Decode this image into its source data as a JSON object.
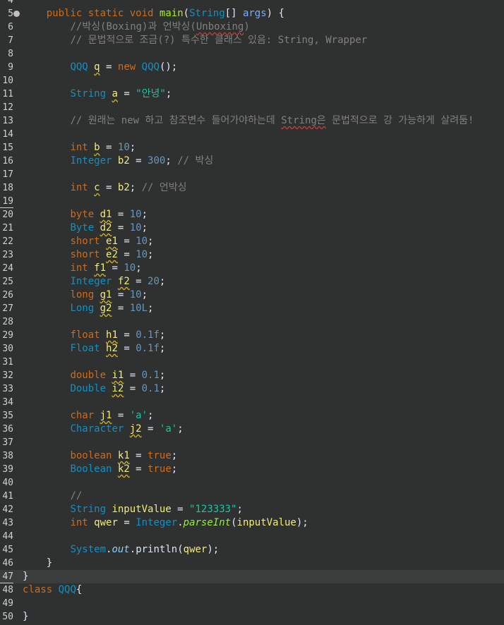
{
  "editor": {
    "first_line_number": "4",
    "current_line": 47,
    "lines": [
      {
        "n": "4",
        "tokens": []
      },
      {
        "n": "5",
        "fold": true,
        "tokens": [
          {
            "t": "    ",
            "c": "plain"
          },
          {
            "t": "public",
            "c": "keyword"
          },
          {
            "t": " ",
            "c": "plain"
          },
          {
            "t": "static",
            "c": "keyword"
          },
          {
            "t": " ",
            "c": "plain"
          },
          {
            "t": "void",
            "c": "keyword"
          },
          {
            "t": " ",
            "c": "plain"
          },
          {
            "t": "main",
            "c": "method"
          },
          {
            "t": "(",
            "c": "op"
          },
          {
            "t": "String",
            "c": "type"
          },
          {
            "t": "[] ",
            "c": "op"
          },
          {
            "t": "args",
            "c": "param"
          },
          {
            "t": ") {",
            "c": "op"
          }
        ]
      },
      {
        "n": "6",
        "tokens": [
          {
            "t": "        ",
            "c": "plain"
          },
          {
            "t": "//박싱(Boxing)과 언박싱(",
            "c": "comment"
          },
          {
            "t": "Unboxing",
            "c": "comment-warn"
          },
          {
            "t": ")",
            "c": "comment"
          }
        ]
      },
      {
        "n": "7",
        "tokens": [
          {
            "t": "        ",
            "c": "plain"
          },
          {
            "t": "// 문법적으로 조금(?) 특수한 클래스 있음: String, Wrapper",
            "c": "comment"
          }
        ]
      },
      {
        "n": "8",
        "tokens": []
      },
      {
        "n": "9",
        "tokens": [
          {
            "t": "        ",
            "c": "plain"
          },
          {
            "t": "QQQ",
            "c": "type"
          },
          {
            "t": " ",
            "c": "plain"
          },
          {
            "t": "q",
            "c": "local-warn"
          },
          {
            "t": " = ",
            "c": "op"
          },
          {
            "t": "new",
            "c": "keyword"
          },
          {
            "t": " ",
            "c": "plain"
          },
          {
            "t": "QQQ",
            "c": "type"
          },
          {
            "t": "();",
            "c": "op"
          }
        ]
      },
      {
        "n": "10",
        "tokens": []
      },
      {
        "n": "11",
        "tokens": [
          {
            "t": "        ",
            "c": "plain"
          },
          {
            "t": "String",
            "c": "type"
          },
          {
            "t": " ",
            "c": "plain"
          },
          {
            "t": "a",
            "c": "local-warn"
          },
          {
            "t": " = ",
            "c": "op"
          },
          {
            "t": "\"안녕\"",
            "c": "string"
          },
          {
            "t": ";",
            "c": "op"
          }
        ]
      },
      {
        "n": "12",
        "tokens": []
      },
      {
        "n": "13",
        "tokens": [
          {
            "t": "        ",
            "c": "plain"
          },
          {
            "t": "// 원래는 new 하고 참조변수 들어가야하는데 ",
            "c": "comment"
          },
          {
            "t": "String은",
            "c": "comment-warn"
          },
          {
            "t": " 문법적으로 강 가능하게 살려둠!",
            "c": "comment"
          }
        ]
      },
      {
        "n": "14",
        "tokens": []
      },
      {
        "n": "15",
        "tokens": [
          {
            "t": "        ",
            "c": "plain"
          },
          {
            "t": "int",
            "c": "keyword"
          },
          {
            "t": " ",
            "c": "plain"
          },
          {
            "t": "b",
            "c": "local-warn"
          },
          {
            "t": " = ",
            "c": "op"
          },
          {
            "t": "10",
            "c": "number"
          },
          {
            "t": ";",
            "c": "op"
          }
        ]
      },
      {
        "n": "16",
        "tokens": [
          {
            "t": "        ",
            "c": "plain"
          },
          {
            "t": "Integer",
            "c": "type"
          },
          {
            "t": " ",
            "c": "plain"
          },
          {
            "t": "b2",
            "c": "local"
          },
          {
            "t": " = ",
            "c": "op"
          },
          {
            "t": "300",
            "c": "number"
          },
          {
            "t": "; ",
            "c": "op"
          },
          {
            "t": "// 박싱",
            "c": "comment"
          }
        ]
      },
      {
        "n": "17",
        "tokens": []
      },
      {
        "n": "18",
        "tokens": [
          {
            "t": "        ",
            "c": "plain"
          },
          {
            "t": "int",
            "c": "keyword"
          },
          {
            "t": " ",
            "c": "plain"
          },
          {
            "t": "c",
            "c": "local-warn"
          },
          {
            "t": " = ",
            "c": "op"
          },
          {
            "t": "b2",
            "c": "local"
          },
          {
            "t": "; ",
            "c": "op"
          },
          {
            "t": "// 언박싱",
            "c": "comment"
          }
        ]
      },
      {
        "n": "19",
        "ul": true,
        "tokens": []
      },
      {
        "n": "20",
        "tokens": [
          {
            "t": "        ",
            "c": "plain"
          },
          {
            "t": "byte",
            "c": "keyword"
          },
          {
            "t": " ",
            "c": "plain"
          },
          {
            "t": "d1",
            "c": "local-warn"
          },
          {
            "t": " = ",
            "c": "op"
          },
          {
            "t": "10",
            "c": "number"
          },
          {
            "t": ";",
            "c": "op"
          }
        ]
      },
      {
        "n": "21",
        "tokens": [
          {
            "t": "        ",
            "c": "plain"
          },
          {
            "t": "Byte",
            "c": "type"
          },
          {
            "t": " ",
            "c": "plain"
          },
          {
            "t": "d2",
            "c": "local-warn"
          },
          {
            "t": " = ",
            "c": "op"
          },
          {
            "t": "10",
            "c": "number"
          },
          {
            "t": ";",
            "c": "op"
          }
        ]
      },
      {
        "n": "22",
        "tokens": [
          {
            "t": "        ",
            "c": "plain"
          },
          {
            "t": "short",
            "c": "keyword"
          },
          {
            "t": " ",
            "c": "plain"
          },
          {
            "t": "e1",
            "c": "local-warn"
          },
          {
            "t": " = ",
            "c": "op"
          },
          {
            "t": "10",
            "c": "number"
          },
          {
            "t": ";",
            "c": "op"
          }
        ]
      },
      {
        "n": "23",
        "tokens": [
          {
            "t": "        ",
            "c": "plain"
          },
          {
            "t": "short",
            "c": "keyword"
          },
          {
            "t": " ",
            "c": "plain"
          },
          {
            "t": "e2",
            "c": "local-warn"
          },
          {
            "t": " = ",
            "c": "op"
          },
          {
            "t": "10",
            "c": "number"
          },
          {
            "t": ";",
            "c": "op"
          }
        ]
      },
      {
        "n": "24",
        "tokens": [
          {
            "t": "        ",
            "c": "plain"
          },
          {
            "t": "int",
            "c": "keyword"
          },
          {
            "t": " ",
            "c": "plain"
          },
          {
            "t": "f1",
            "c": "local-warn"
          },
          {
            "t": " = ",
            "c": "op"
          },
          {
            "t": "10",
            "c": "number"
          },
          {
            "t": ";",
            "c": "op"
          }
        ]
      },
      {
        "n": "25",
        "tokens": [
          {
            "t": "        ",
            "c": "plain"
          },
          {
            "t": "Integer",
            "c": "type"
          },
          {
            "t": " ",
            "c": "plain"
          },
          {
            "t": "f2",
            "c": "local-warn"
          },
          {
            "t": " = ",
            "c": "op"
          },
          {
            "t": "20",
            "c": "number"
          },
          {
            "t": ";",
            "c": "op"
          }
        ]
      },
      {
        "n": "26",
        "tokens": [
          {
            "t": "        ",
            "c": "plain"
          },
          {
            "t": "long",
            "c": "keyword"
          },
          {
            "t": " ",
            "c": "plain"
          },
          {
            "t": "g1",
            "c": "local-warn"
          },
          {
            "t": " = ",
            "c": "op"
          },
          {
            "t": "10",
            "c": "number"
          },
          {
            "t": ";",
            "c": "op"
          }
        ]
      },
      {
        "n": "27",
        "tokens": [
          {
            "t": "        ",
            "c": "plain"
          },
          {
            "t": "Long",
            "c": "type"
          },
          {
            "t": " ",
            "c": "plain"
          },
          {
            "t": "g2",
            "c": "local-warn"
          },
          {
            "t": " = ",
            "c": "op"
          },
          {
            "t": "10L",
            "c": "number"
          },
          {
            "t": ";",
            "c": "op"
          }
        ]
      },
      {
        "n": "28",
        "tokens": []
      },
      {
        "n": "29",
        "tokens": [
          {
            "t": "        ",
            "c": "plain"
          },
          {
            "t": "float",
            "c": "keyword"
          },
          {
            "t": " ",
            "c": "plain"
          },
          {
            "t": "h1",
            "c": "local-warn"
          },
          {
            "t": " = ",
            "c": "op"
          },
          {
            "t": "0.1f",
            "c": "number"
          },
          {
            "t": ";",
            "c": "op"
          }
        ]
      },
      {
        "n": "30",
        "tokens": [
          {
            "t": "        ",
            "c": "plain"
          },
          {
            "t": "Float",
            "c": "type"
          },
          {
            "t": " ",
            "c": "plain"
          },
          {
            "t": "h2",
            "c": "local-warn"
          },
          {
            "t": " = ",
            "c": "op"
          },
          {
            "t": "0.1f",
            "c": "number"
          },
          {
            "t": ";",
            "c": "op"
          }
        ]
      },
      {
        "n": "31",
        "tokens": []
      },
      {
        "n": "32",
        "tokens": [
          {
            "t": "        ",
            "c": "plain"
          },
          {
            "t": "double",
            "c": "keyword"
          },
          {
            "t": " ",
            "c": "plain"
          },
          {
            "t": "i1",
            "c": "local-warn"
          },
          {
            "t": " = ",
            "c": "op"
          },
          {
            "t": "0.1",
            "c": "number"
          },
          {
            "t": ";",
            "c": "op"
          }
        ]
      },
      {
        "n": "33",
        "tokens": [
          {
            "t": "        ",
            "c": "plain"
          },
          {
            "t": "Double",
            "c": "type"
          },
          {
            "t": " ",
            "c": "plain"
          },
          {
            "t": "i2",
            "c": "local-warn"
          },
          {
            "t": " = ",
            "c": "op"
          },
          {
            "t": "0.1",
            "c": "number"
          },
          {
            "t": ";",
            "c": "op"
          }
        ]
      },
      {
        "n": "34",
        "tokens": []
      },
      {
        "n": "35",
        "tokens": [
          {
            "t": "        ",
            "c": "plain"
          },
          {
            "t": "char",
            "c": "keyword"
          },
          {
            "t": " ",
            "c": "plain"
          },
          {
            "t": "j1",
            "c": "local-warn"
          },
          {
            "t": " = ",
            "c": "op"
          },
          {
            "t": "'a'",
            "c": "string"
          },
          {
            "t": ";",
            "c": "op"
          }
        ]
      },
      {
        "n": "36",
        "tokens": [
          {
            "t": "        ",
            "c": "plain"
          },
          {
            "t": "Character",
            "c": "type"
          },
          {
            "t": " ",
            "c": "plain"
          },
          {
            "t": "j2",
            "c": "local-warn"
          },
          {
            "t": " = ",
            "c": "op"
          },
          {
            "t": "'a'",
            "c": "string"
          },
          {
            "t": ";",
            "c": "op"
          }
        ]
      },
      {
        "n": "37",
        "tokens": []
      },
      {
        "n": "38",
        "tokens": [
          {
            "t": "        ",
            "c": "plain"
          },
          {
            "t": "boolean",
            "c": "keyword"
          },
          {
            "t": " ",
            "c": "plain"
          },
          {
            "t": "k1",
            "c": "local-warn"
          },
          {
            "t": " = ",
            "c": "op"
          },
          {
            "t": "true",
            "c": "keyword"
          },
          {
            "t": ";",
            "c": "op"
          }
        ]
      },
      {
        "n": "39",
        "tokens": [
          {
            "t": "        ",
            "c": "plain"
          },
          {
            "t": "Boolean",
            "c": "type"
          },
          {
            "t": " ",
            "c": "plain"
          },
          {
            "t": "k2",
            "c": "local-warn"
          },
          {
            "t": " = ",
            "c": "op"
          },
          {
            "t": "true",
            "c": "keyword"
          },
          {
            "t": ";",
            "c": "op"
          }
        ]
      },
      {
        "n": "40",
        "tokens": []
      },
      {
        "n": "41",
        "tokens": [
          {
            "t": "        ",
            "c": "plain"
          },
          {
            "t": "//",
            "c": "comment"
          }
        ]
      },
      {
        "n": "42",
        "tokens": [
          {
            "t": "        ",
            "c": "plain"
          },
          {
            "t": "String",
            "c": "type"
          },
          {
            "t": " ",
            "c": "plain"
          },
          {
            "t": "inputValue",
            "c": "local"
          },
          {
            "t": " = ",
            "c": "op"
          },
          {
            "t": "\"123333\"",
            "c": "string"
          },
          {
            "t": ";",
            "c": "op"
          }
        ]
      },
      {
        "n": "43",
        "tokens": [
          {
            "t": "        ",
            "c": "plain"
          },
          {
            "t": "int",
            "c": "keyword"
          },
          {
            "t": " ",
            "c": "plain"
          },
          {
            "t": "qwer",
            "c": "local"
          },
          {
            "t": " = ",
            "c": "op"
          },
          {
            "t": "Integer",
            "c": "type"
          },
          {
            "t": ".",
            "c": "op"
          },
          {
            "t": "parseInt",
            "c": "method-static"
          },
          {
            "t": "(",
            "c": "op"
          },
          {
            "t": "inputValue",
            "c": "local"
          },
          {
            "t": ");",
            "c": "op"
          }
        ]
      },
      {
        "n": "44",
        "tokens": []
      },
      {
        "n": "45",
        "tokens": [
          {
            "t": "        ",
            "c": "plain"
          },
          {
            "t": "System",
            "c": "type"
          },
          {
            "t": ".",
            "c": "op"
          },
          {
            "t": "out",
            "c": "field-static"
          },
          {
            "t": ".",
            "c": "op"
          },
          {
            "t": "println",
            "c": "member"
          },
          {
            "t": "(",
            "c": "op"
          },
          {
            "t": "qwer",
            "c": "local"
          },
          {
            "t": ");",
            "c": "op"
          }
        ]
      },
      {
        "n": "46",
        "tokens": [
          {
            "t": "    ",
            "c": "plain"
          },
          {
            "t": "}",
            "c": "op"
          }
        ]
      },
      {
        "n": "47",
        "ul": true,
        "current": true,
        "tokens": [
          {
            "t": "}",
            "c": "op"
          }
        ]
      },
      {
        "n": "48",
        "tokens": [
          {
            "t": "class",
            "c": "keyword"
          },
          {
            "t": " ",
            "c": "plain"
          },
          {
            "t": "QQQ",
            "c": "type"
          },
          {
            "t": "{",
            "c": "op"
          }
        ]
      },
      {
        "n": "49",
        "tokens": []
      },
      {
        "n": "50",
        "tokens": [
          {
            "t": "}",
            "c": "op"
          }
        ]
      }
    ]
  }
}
